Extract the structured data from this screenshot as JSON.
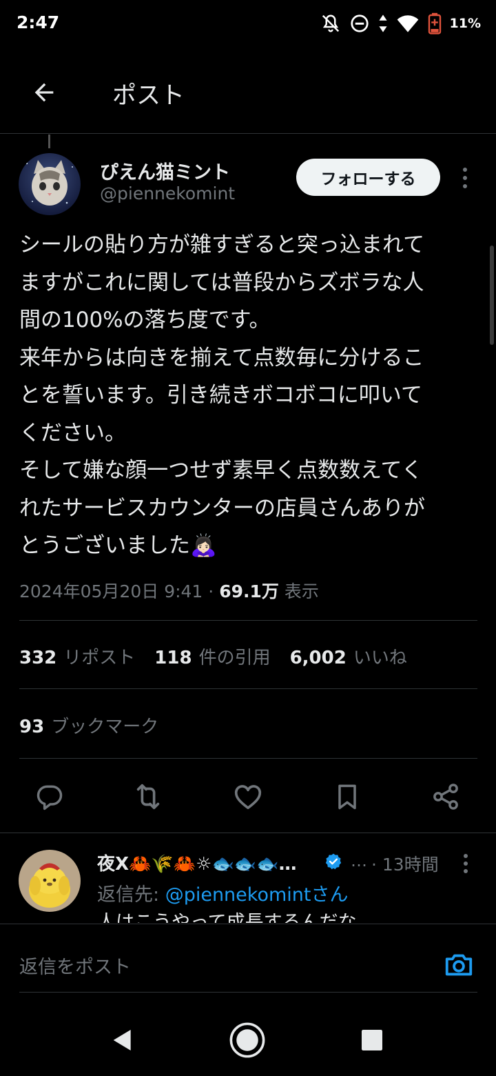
{
  "status_bar": {
    "time": "2:47",
    "battery": "11%",
    "icons": [
      "notifications-off-icon",
      "do-not-disturb-icon",
      "data-arrows-icon",
      "wifi-icon",
      "battery-low-icon"
    ]
  },
  "header": {
    "title": "ポスト",
    "back_icon": "back-arrow-icon"
  },
  "tweet": {
    "author_name": "ぴえん猫ミント",
    "author_handle": "@piennekomint",
    "follow_label": "フォローする",
    "text_lines": [
      "シールの貼り方が雑すぎると突っ込まれて",
      "ますがこれに関しては普段からズボラな人",
      "間の100%の落ち度です。",
      "来年からは向きを揃えて点数毎に分けるこ",
      "とを誓います。引き続きボコボコに叩いて",
      "ください。",
      "そして嫌な顔一つせず素早く点数数えてく",
      "れたサービスカウンターの店員さんありが",
      "とうございました🙇🏻‍♀️"
    ],
    "timestamp": "2024年05月20日 9:41 · ",
    "views_count": "69.1万",
    "views_label": " 表示",
    "stats": {
      "reposts_count": "332",
      "reposts_label": "リポスト",
      "quotes_count": "118",
      "quotes_label": "件の引用",
      "likes_count": "6,002",
      "likes_label": "いいね"
    },
    "bookmarks_count": "93",
    "bookmarks_label": "ブックマーク"
  },
  "actions": [
    "reply-icon",
    "repost-icon",
    "like-icon",
    "bookmark-icon",
    "share-icon"
  ],
  "reply": {
    "author_name": "夜X🦀🌾🦀☼🐟🐟🐟…",
    "ellipsis": "…",
    "time": "· 13時間",
    "reply_to_prefix": "返信先: ",
    "reply_to_mention": "@piennekomintさん",
    "text": "人はこうやって成長するんだな"
  },
  "compose": {
    "placeholder": "返信をポスト"
  },
  "colors": {
    "background": "#000000",
    "text": "#e7e9ea",
    "secondary": "#71767b",
    "accent": "#1d9bf0",
    "divider": "#2f3336"
  }
}
